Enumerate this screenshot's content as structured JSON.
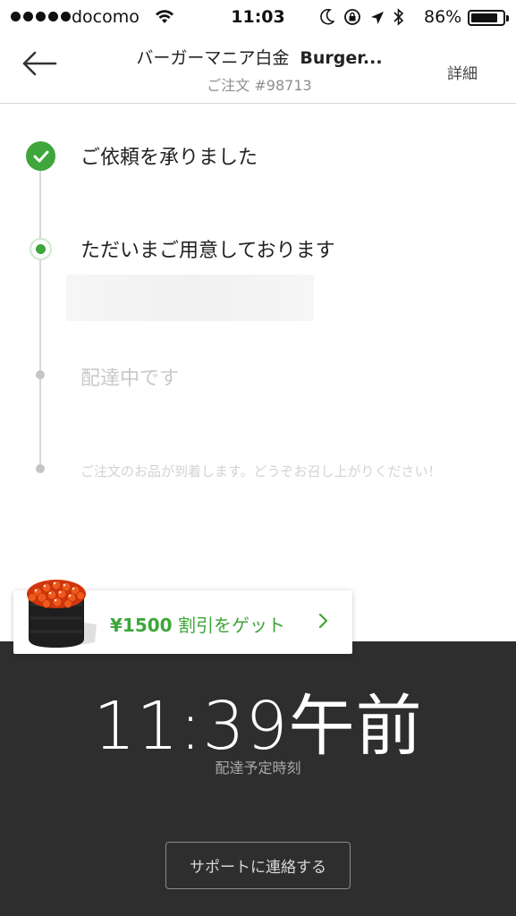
{
  "status_bar": {
    "carrier": "docomo",
    "time": "11:03",
    "battery": "86%",
    "battery_level": 0.86,
    "icons": [
      "signal-dots-icon",
      "wifi-icon",
      "moon-icon",
      "rotation-lock-icon",
      "location-arrow-icon",
      "bluetooth-icon",
      "battery-icon"
    ]
  },
  "header": {
    "back_icon": "back-arrow-icon",
    "shop_name_jp": "バーガーマニア白金",
    "shop_name_en": "Burger...",
    "order_number": "ご注文 #98713",
    "details_label": "詳細"
  },
  "timeline": {
    "steps": [
      {
        "label": "ご依頼を承りました",
        "state": "done"
      },
      {
        "label": "ただいまご用意しております",
        "state": "active"
      },
      {
        "label": "配達中です",
        "state": "pending"
      },
      {
        "label": "ご注文のお品が到着します。どうぞお召し上がりください！",
        "state": "pending"
      }
    ]
  },
  "promo": {
    "amount": "¥1500",
    "text": " 割引をゲット",
    "chevron_icon": "chevron-right-icon",
    "image_icon": "ikura-sushi-icon"
  },
  "eta": {
    "time": "11:39午前",
    "label": "配達予定時刻"
  },
  "support": {
    "button_label": "サポートに連絡する"
  },
  "colors": {
    "accent_green": "#3ea63a",
    "dark_panel": "#2e2e2e"
  }
}
